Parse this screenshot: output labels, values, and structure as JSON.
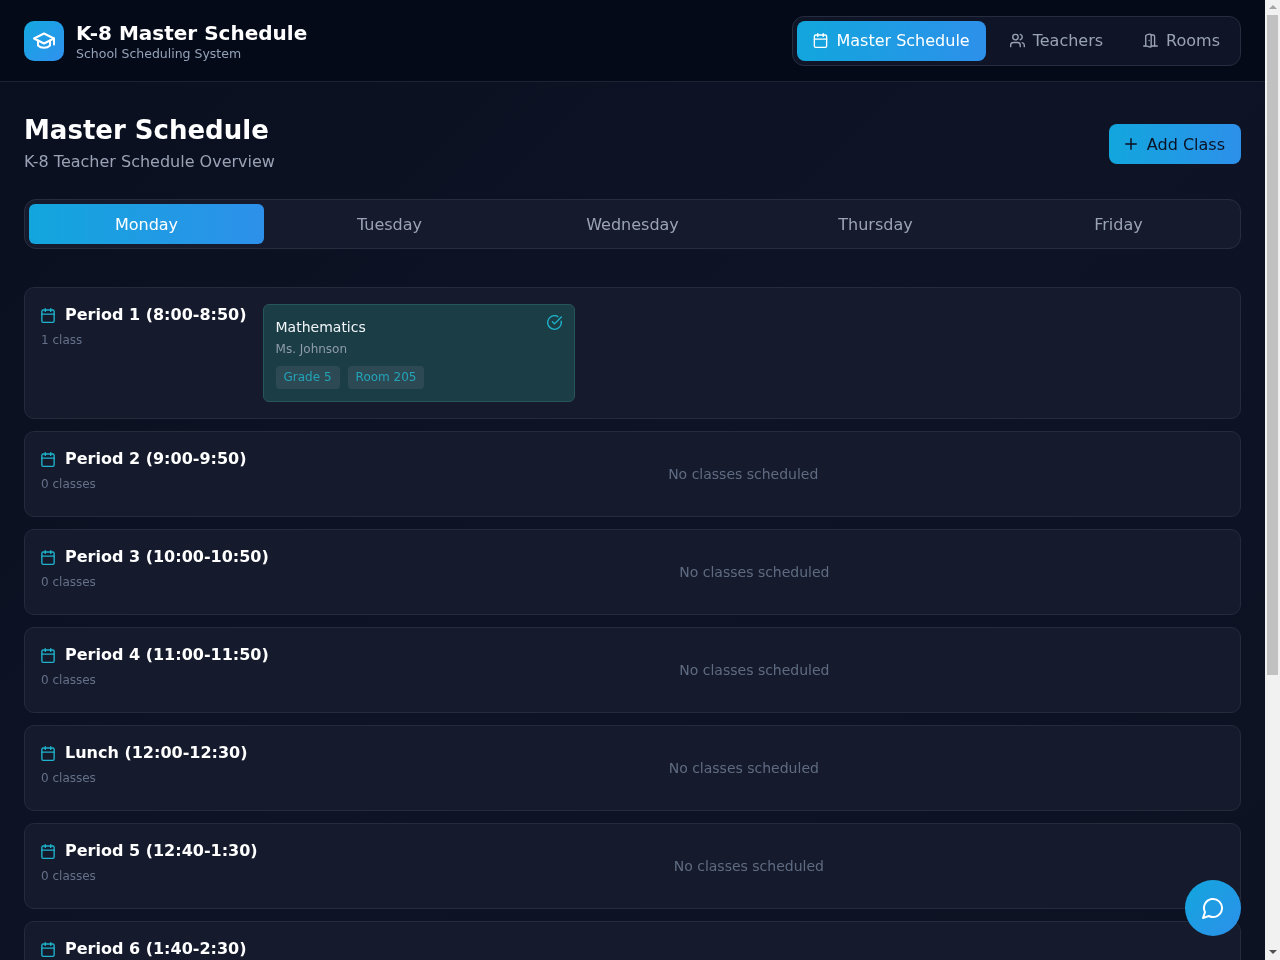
{
  "app": {
    "title": "K-8 Master Schedule",
    "subtitle": "School Scheduling System"
  },
  "nav_tabs": [
    {
      "label": "Master Schedule",
      "selected": true,
      "kind": "calendar"
    },
    {
      "label": "Teachers",
      "selected": false,
      "kind": "people"
    },
    {
      "label": "Rooms",
      "selected": false,
      "kind": "door"
    }
  ],
  "page": {
    "title": "Master Schedule",
    "subtitle": "K-8 Teacher Schedule Overview",
    "add_button": "Add Class"
  },
  "day_tabs": [
    {
      "label": "Monday",
      "selected": true
    },
    {
      "label": "Tuesday",
      "selected": false
    },
    {
      "label": "Wednesday",
      "selected": false
    },
    {
      "label": "Thursday",
      "selected": false
    },
    {
      "label": "Friday",
      "selected": false
    }
  ],
  "periods": [
    {
      "title": "Period 1 (8:00-8:50)",
      "count": "1 class",
      "classes": [
        {
          "subject": "Mathematics",
          "teacher": "Ms. Johnson",
          "tags": [
            "Grade 5",
            "Room 205"
          ],
          "confirmed": true
        }
      ]
    },
    {
      "title": "Period 2 (9:00-9:50)",
      "count": "0 classes",
      "empty_text": "No classes scheduled"
    },
    {
      "title": "Period 3 (10:00-10:50)",
      "count": "0 classes",
      "empty_text": "No classes scheduled"
    },
    {
      "title": "Period 4 (11:00-11:50)",
      "count": "0 classes",
      "empty_text": "No classes scheduled"
    },
    {
      "title": "Lunch (12:00-12:30)",
      "count": "0 classes",
      "empty_text": "No classes scheduled"
    },
    {
      "title": "Period 5 (12:40-1:30)",
      "count": "0 classes",
      "empty_text": "No classes scheduled"
    },
    {
      "title": "Period 6 (1:40-2:30)"
    }
  ]
}
